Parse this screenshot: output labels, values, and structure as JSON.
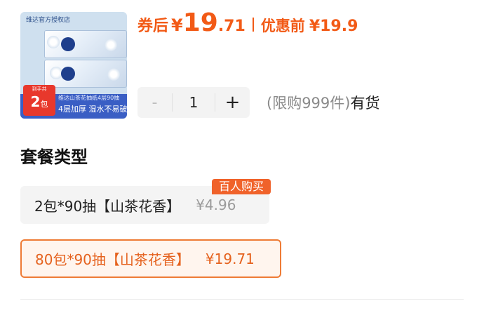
{
  "product": {
    "thumbnail": {
      "store_label": "维达官方授权店",
      "banner_top": "维达山茶花抽纸4层90抽",
      "banner_text": "4层加厚 湿水不易破",
      "badge_top": "到手共",
      "badge_count": "2",
      "badge_unit": "包"
    },
    "price": {
      "coupon_label": "券后",
      "currency": "¥",
      "coupon_price_int": "19",
      "coupon_price_dec": ".71",
      "original_label": "优惠前",
      "original_price": "¥19.9"
    }
  },
  "quantity": {
    "minus_label": "-",
    "value": "1",
    "plus_label": "+"
  },
  "stock": {
    "limit_text": "(限购999件)",
    "status": "有货"
  },
  "package": {
    "title": "套餐类型",
    "options": [
      {
        "name": "2包*90抽【山茶花香】",
        "price": "¥4.96",
        "tag": "百人购买",
        "selected": false
      },
      {
        "name": "80包*90抽【山茶花香】",
        "price": "¥19.71",
        "selected": true
      }
    ]
  },
  "colors": {
    "accent": "#f25a16",
    "selected_border": "#ee7b35",
    "selected_bg": "#fff5ee",
    "tag_bg": "#f0622a"
  }
}
